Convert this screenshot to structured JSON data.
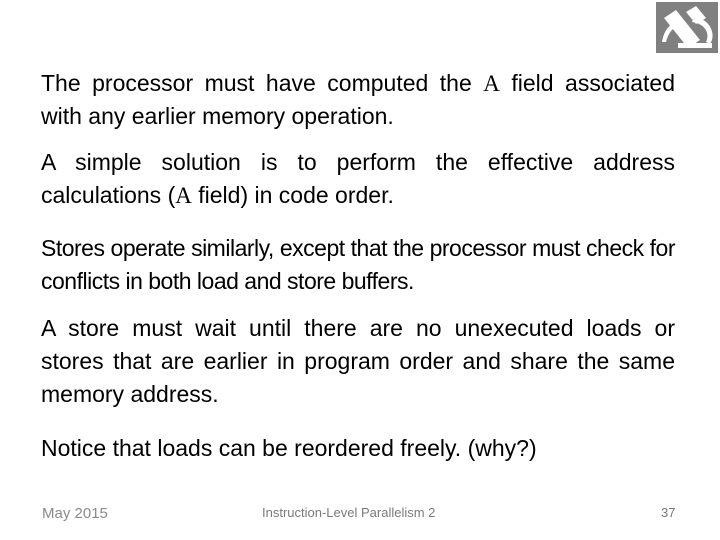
{
  "slide": {
    "paragraphs": [
      {
        "before": "The processor must have computed the ",
        "symbol": "A",
        "after": " field associated with any earlier memory operation."
      },
      {
        "before": "A simple solution is to perform the effective address calculations (",
        "symbol": "A",
        "after": " field) in code order."
      },
      {
        "text": "Stores operate similarly, except that the processor must check for conflicts in both load and store buffers."
      },
      {
        "text": "A store must wait until there are no unexecuted loads or stores that are earlier in program order and share the same memory address."
      },
      {
        "text": "Notice that loads can be reordered freely. (why?)"
      }
    ]
  },
  "footer": {
    "date": "May 2015",
    "title": "Instruction-Level Parallelism 2",
    "page": "37"
  },
  "logo": {
    "icon": "microscope-icon",
    "background": "#808080"
  }
}
